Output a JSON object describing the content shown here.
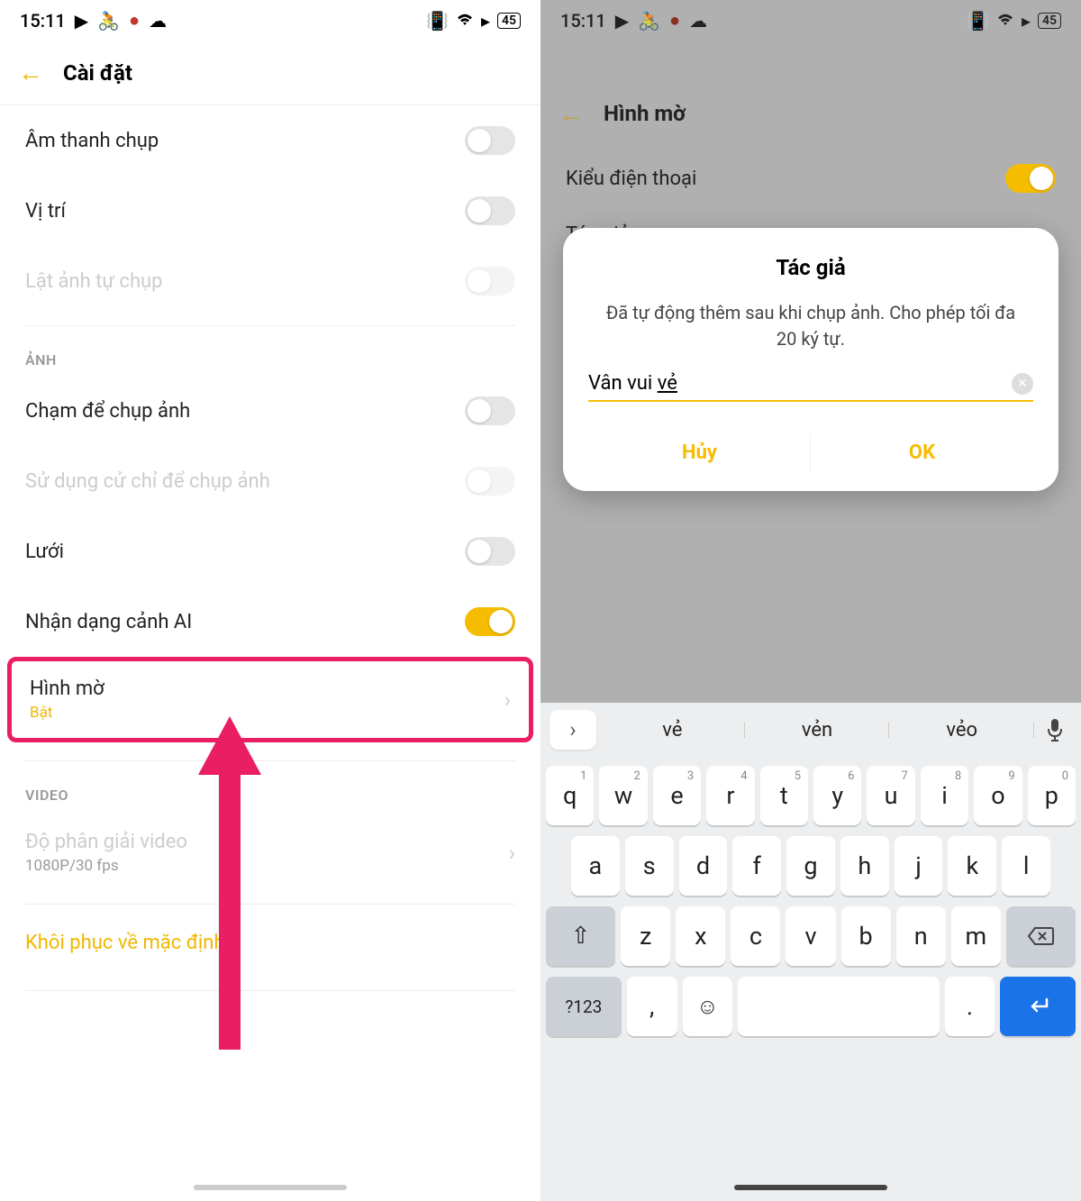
{
  "status": {
    "time": "15:11",
    "battery": "45"
  },
  "left": {
    "title": "Cài đặt",
    "rows": {
      "shutter_sound": "Âm thanh chụp",
      "location": "Vị trí",
      "flip_selfie": "Lật ảnh tự chụp",
      "section_photo": "ẢNH",
      "tap_shoot": "Chạm để chụp ảnh",
      "gesture_shoot": "Sử dụng cử chỉ để chụp ảnh",
      "grid": "Lưới",
      "ai_scene": "Nhận dạng cảnh AI",
      "watermark": "Hình mờ",
      "watermark_state": "Bật",
      "section_video": "VIDEO",
      "video_res": "Độ phân giải video",
      "video_res_val": "1080P/30 fps",
      "restore": "Khôi phục về mặc định"
    }
  },
  "right": {
    "title": "Hình mờ",
    "phone_model": "Kiểu điện thoại",
    "author_label": "Tác giả",
    "dialog": {
      "title": "Tác giả",
      "desc": "Đã tự động thêm sau khi chụp ảnh. Cho phép tối đa 20 ký tự.",
      "value_prefix": "Vân vui ",
      "value_underlined": "vẻ",
      "cancel": "Hủy",
      "ok": "OK"
    },
    "suggestions": [
      "vẻ",
      "vẻn",
      "vẻo"
    ],
    "keyboard": {
      "r1": [
        {
          "k": "q",
          "n": "1"
        },
        {
          "k": "w",
          "n": "2"
        },
        {
          "k": "e",
          "n": "3"
        },
        {
          "k": "r",
          "n": "4"
        },
        {
          "k": "t",
          "n": "5"
        },
        {
          "k": "y",
          "n": "6"
        },
        {
          "k": "u",
          "n": "7"
        },
        {
          "k": "i",
          "n": "8"
        },
        {
          "k": "o",
          "n": "9"
        },
        {
          "k": "p",
          "n": "0"
        }
      ],
      "r2": [
        "a",
        "s",
        "d",
        "f",
        "g",
        "h",
        "j",
        "k",
        "l"
      ],
      "r3": [
        "z",
        "x",
        "c",
        "v",
        "b",
        "n",
        "m"
      ],
      "numkey": "?123",
      "comma": ",",
      "period": "."
    }
  }
}
